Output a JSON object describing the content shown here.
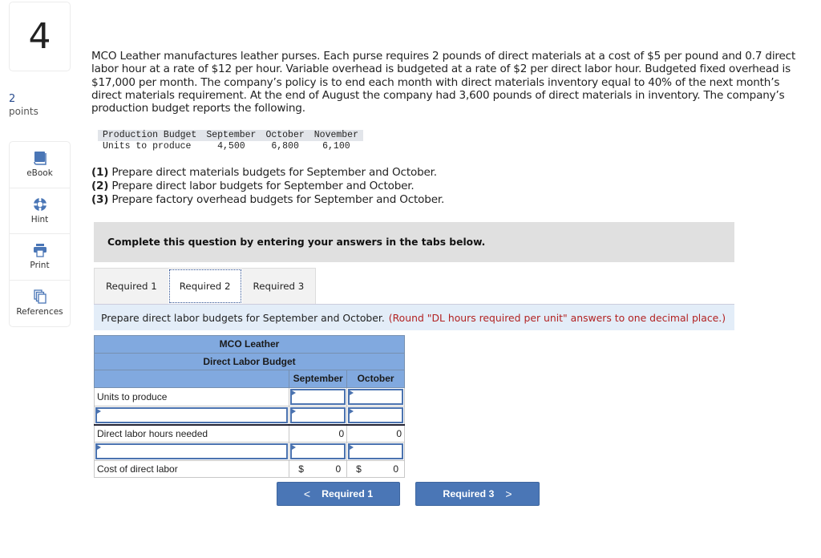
{
  "question": {
    "number": "4",
    "points_value": "2",
    "points_label": "points"
  },
  "tools": [
    {
      "label": "eBook",
      "icon": "book-icon"
    },
    {
      "label": "Hint",
      "icon": "lifebuoy-icon"
    },
    {
      "label": "Print",
      "icon": "printer-icon"
    },
    {
      "label": "References",
      "icon": "documents-icon"
    }
  ],
  "problem_text": "MCO Leather manufactures leather purses. Each purse requires 2 pounds of direct materials at a cost of $5 per pound and 0.7 direct labor hour at a rate of $12 per hour. Variable overhead is budgeted at a rate of $2 per direct labor hour. Budgeted fixed overhead is $17,000 per month. The company’s policy is to end each month with direct materials inventory equal to 40% of the next month’s direct materials requirement. At the end of August the company had 3,600 pounds of direct materials in inventory. The company’s production budget reports the following.",
  "production_budget": {
    "headers": [
      "Production Budget",
      "September",
      "October",
      "November"
    ],
    "row_label": "Units to produce",
    "values": [
      "4,500",
      "6,800",
      "6,100"
    ]
  },
  "requirements": [
    {
      "num": "(1)",
      "text": " Prepare direct materials budgets for September and October."
    },
    {
      "num": "(2)",
      "text": " Prepare direct labor budgets for September and October."
    },
    {
      "num": "(3)",
      "text": " Prepare factory overhead budgets for September and October."
    }
  ],
  "complete_prompt": "Complete this question by entering your answers in the tabs below.",
  "tabs": [
    {
      "label": "Required 1",
      "active": false
    },
    {
      "label": "Required 2",
      "active": true
    },
    {
      "label": "Required 3",
      "active": false
    }
  ],
  "instruction": {
    "text": "Prepare direct labor budgets for September and October.",
    "note": "(Round \"DL hours required per unit\" answers to one decimal place.)"
  },
  "budget_table": {
    "company": "MCO Leather",
    "title": "Direct Labor Budget",
    "columns": [
      "September",
      "October"
    ],
    "rows": {
      "units_label": "Units to produce",
      "units_values": [
        "",
        ""
      ],
      "input_label_value": "",
      "input_values": [
        "",
        ""
      ],
      "hours_label": "Direct labor hours needed",
      "hours_values": [
        "0",
        "0"
      ],
      "input2_label_value": "",
      "input2_values": [
        "",
        ""
      ],
      "cost_label": "Cost of direct labor",
      "cost_currency": "$",
      "cost_values": [
        "0",
        "0"
      ]
    }
  },
  "nav": {
    "prev_label": "Required 1",
    "next_label": "Required 3",
    "prev_chevron": "<",
    "next_chevron": ">"
  },
  "colors": {
    "accent": "#4a76b6",
    "table_header": "#81a9df",
    "note_red": "#b22222",
    "instruction_bg": "#e3edf8"
  }
}
